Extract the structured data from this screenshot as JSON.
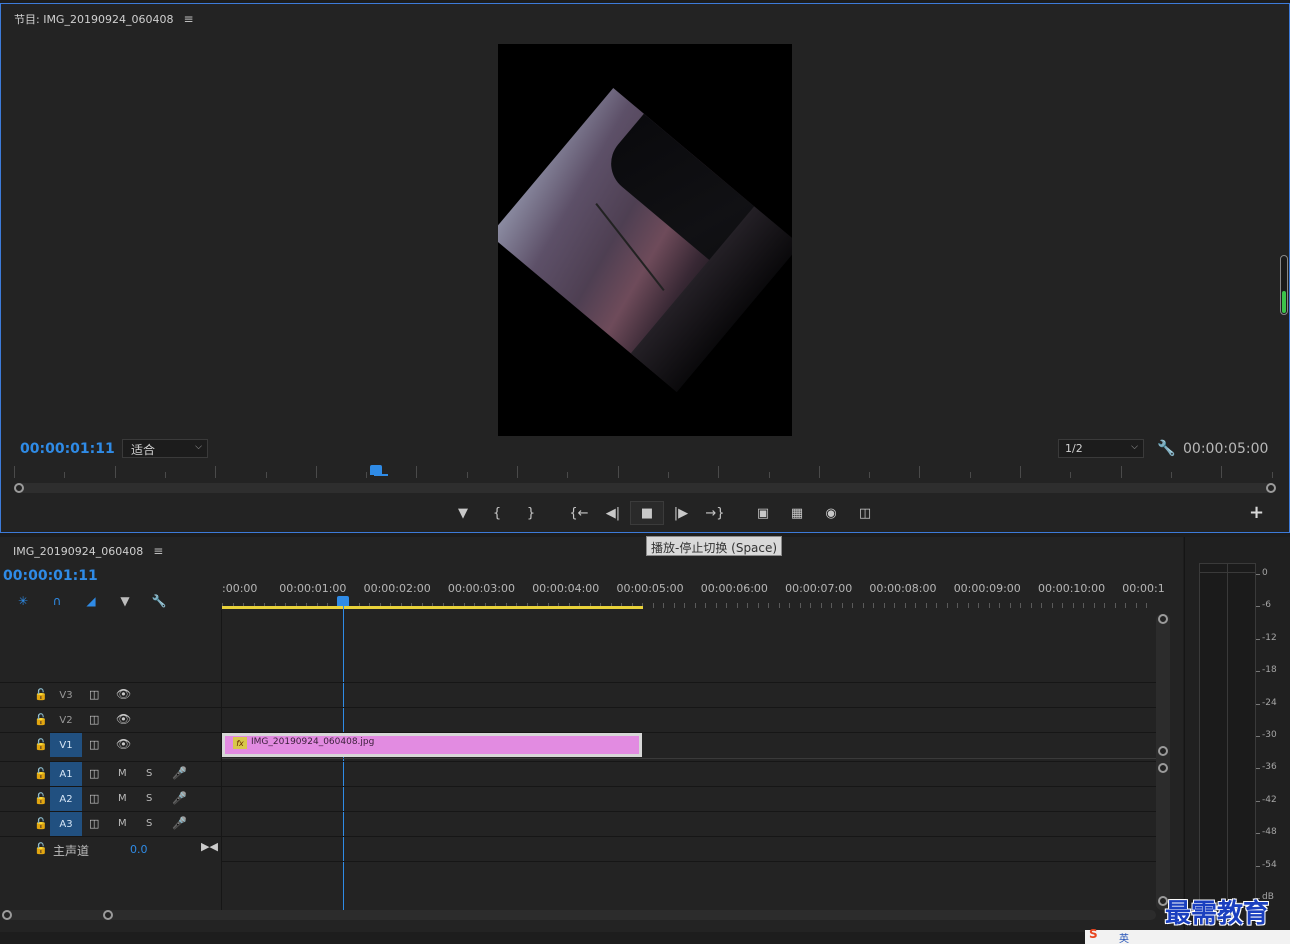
{
  "program_monitor": {
    "title": "节目: IMG_20190924_060408",
    "menu_glyph": "≡",
    "current_timecode": "00:00:01:11",
    "fit_value": "适合",
    "resolution_value": "1/2",
    "duration_timecode": "00:00:05:00"
  },
  "transport": {
    "marker_icon": "marker-icon",
    "mark_in_icon": "mark-in-icon",
    "mark_out_icon": "mark-out-icon",
    "go_to_in_icon": "go-to-in-icon",
    "step_back_icon": "step-back-icon",
    "stop_icon": "stop-icon",
    "step_forward_icon": "step-forward-icon",
    "go_to_out_icon": "go-to-out-icon",
    "lift_icon": "lift-icon",
    "extract_icon": "extract-icon",
    "export_frame_icon": "camera-icon",
    "compare_icon": "compare-icon",
    "add_icon": "plus-icon"
  },
  "tooltip": "播放-停止切换 (Space)",
  "timeline": {
    "sequence_title": "IMG_20190924_060408",
    "menu_glyph": "≡",
    "current_timecode": "00:00:01:11",
    "ruler_labels": [
      ":00:00",
      "00:00:01:00",
      "00:00:02:00",
      "00:00:03:00",
      "00:00:04:00",
      "00:00:05:00",
      "00:00:06:00",
      "00:00:07:00",
      "00:00:08:00",
      "00:00:09:00",
      "00:00:10:00",
      "00:00:1"
    ],
    "tracks": [
      {
        "name": "V3",
        "kind": "video",
        "targeted": false
      },
      {
        "name": "V2",
        "kind": "video",
        "targeted": false
      },
      {
        "name": "V1",
        "kind": "video",
        "targeted": true
      },
      {
        "name": "A1",
        "kind": "audio",
        "targeted": true
      },
      {
        "name": "A2",
        "kind": "audio",
        "targeted": true
      },
      {
        "name": "A3",
        "kind": "audio",
        "targeted": true
      }
    ],
    "audio_mute_label": "M",
    "audio_solo_label": "S",
    "master": {
      "label": "主声道",
      "value": "0.0"
    },
    "clip": {
      "fx_label": "fx",
      "name": "IMG_20190924_060408.jpg",
      "color": "#e28be1"
    }
  },
  "audio_meter": {
    "db_labels": [
      "0",
      "-6",
      "-12",
      "-18",
      "-24",
      "-30",
      "-36",
      "-42",
      "-48",
      "-54",
      "dB"
    ]
  },
  "accent_color": "#2f8be6",
  "watermark": "最需教育",
  "taskbar": {
    "ime": "S",
    "lang": "英"
  }
}
